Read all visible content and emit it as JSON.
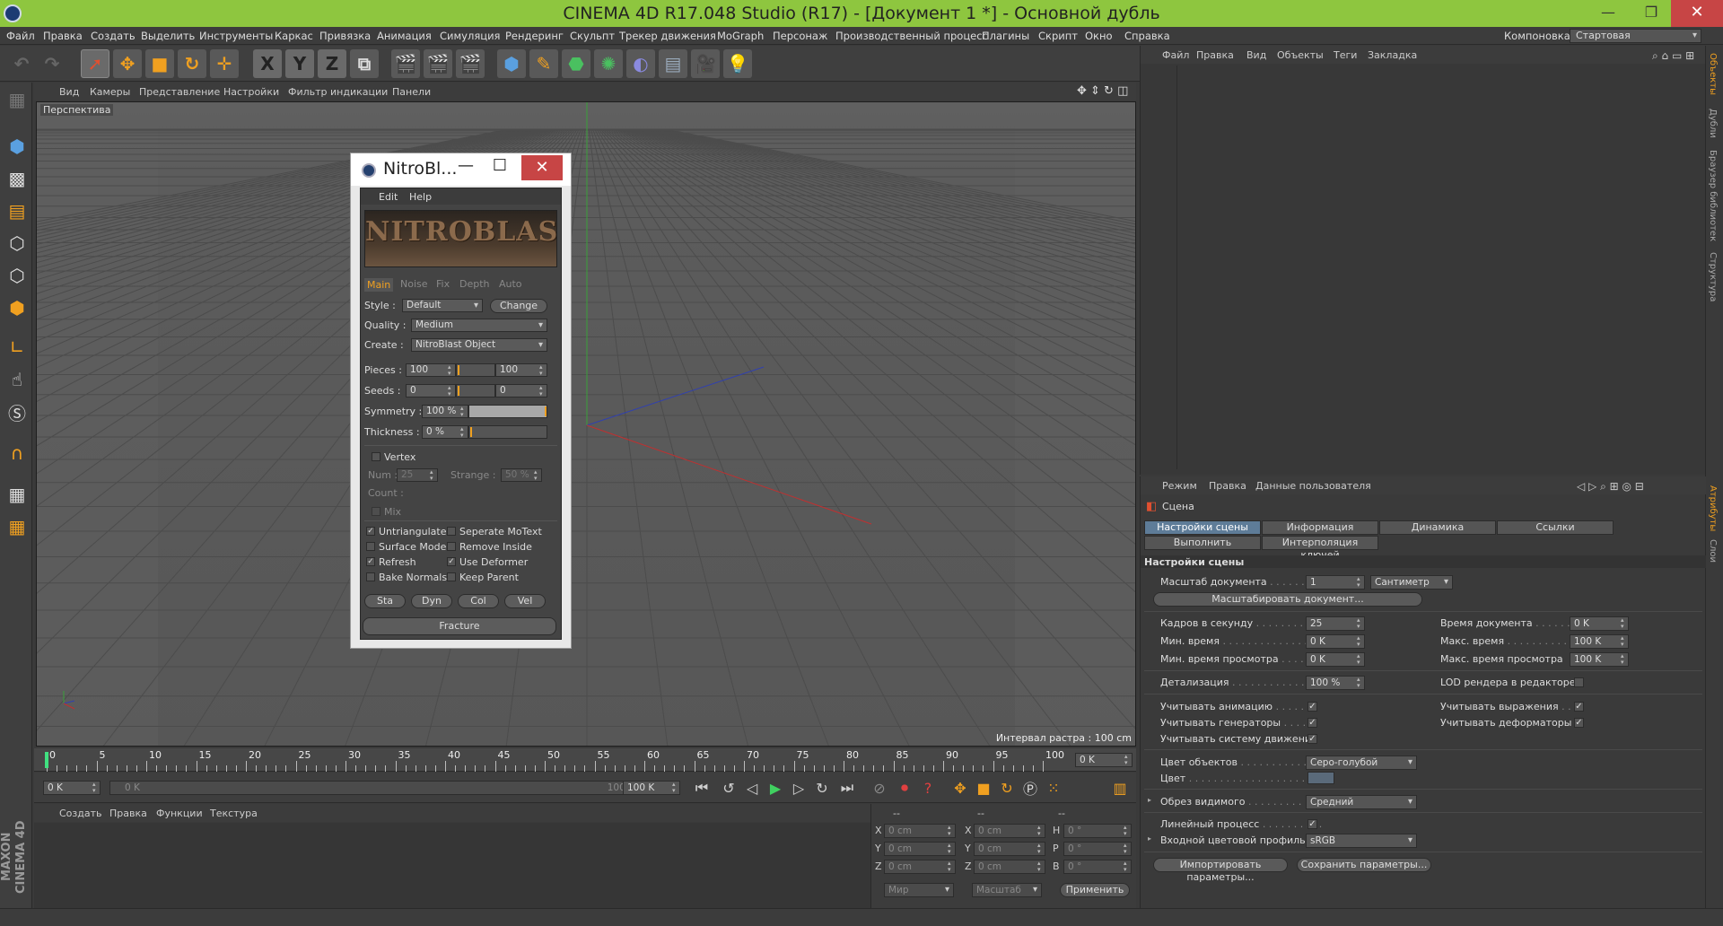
{
  "window": {
    "title": "CINEMA 4D R17.048 Studio (R17) - [Документ 1 *] - Основной дубль",
    "min": "—",
    "max": "❐",
    "close": "✕"
  },
  "menubar": {
    "items": [
      "Файл",
      "Правка",
      "Создать",
      "Выделить",
      "Инструменты",
      "Каркас",
      "Привязка",
      "Анимация",
      "Симуляция",
      "Рендеринг",
      "Скульпт",
      "Трекер движения",
      "MoGraph",
      "Персонаж",
      "Производственный процесс",
      "Плагины",
      "Скрипт",
      "Окно",
      "Справка"
    ],
    "layout_label": "Компоновка",
    "layout_value": "Стартовая"
  },
  "toolbar": {
    "x": "X",
    "y": "Y",
    "z": "Z"
  },
  "viewport": {
    "menu": [
      "Вид",
      "Камеры",
      "Представление",
      "Настройки",
      "Фильтр индикации",
      "Панели"
    ],
    "label": "Перспектива",
    "status": "Интервал растра : 100 cm"
  },
  "timeline": {
    "ticks": [
      "0",
      "5",
      "10",
      "15",
      "20",
      "25",
      "30",
      "35",
      "40",
      "45",
      "50",
      "55",
      "60",
      "65",
      "70",
      "75",
      "80",
      "85",
      "90",
      "95",
      "100"
    ],
    "frame": "0 K"
  },
  "timectrl": {
    "start": "0 K",
    "slider_start": "0 K",
    "slider_end": "100 K",
    "end": "100 K"
  },
  "material": {
    "menu": [
      "Создать",
      "Правка",
      "Функции",
      "Текстура"
    ]
  },
  "coords": {
    "headers": [
      "--",
      "--",
      "--"
    ],
    "rows": [
      {
        "a": "X",
        "v1": "0 cm",
        "b": "X",
        "v2": "0 cm",
        "c": "H",
        "v3": "0 °"
      },
      {
        "a": "Y",
        "v1": "0 cm",
        "b": "Y",
        "v2": "0 cm",
        "c": "P",
        "v3": "0 °"
      },
      {
        "a": "Z",
        "v1": "0 cm",
        "b": "Z",
        "v2": "0 cm",
        "c": "B",
        "v3": "0 °"
      }
    ],
    "world": "Мир",
    "scale": "Масштаб",
    "apply": "Применить"
  },
  "objects": {
    "menu": [
      "Файл",
      "Правка",
      "Вид",
      "Объекты",
      "Теги",
      "Закладка"
    ]
  },
  "right_tabs": [
    "Объекты",
    "Дубли",
    "Браузер библиотек",
    "Структура",
    "Атрибуты",
    "Слои"
  ],
  "attributes": {
    "menu": [
      "Режим",
      "Правка",
      "Данные пользователя"
    ],
    "object": "Сцена",
    "tabs": [
      "Настройки сцены",
      "Информация",
      "Динамика",
      "Ссылки",
      "Выполнить",
      "Интерполяция ключей"
    ],
    "section": "Настройки сцены",
    "doc_scale_label": "Масштаб документа",
    "doc_scale": "1",
    "doc_scale_unit": "Сантиметр",
    "scale_btn": "Масштабировать документ...",
    "fps_label": "Кадров в секунду",
    "fps": "25",
    "doc_time_label": "Время документа",
    "doc_time": "0 K",
    "min_time_label": "Мин. время",
    "min_time": "0 K",
    "max_time_label": "Макс. время",
    "max_time": "100 K",
    "min_prev_label": "Мин. время просмотра",
    "min_prev": "0 K",
    "max_prev_label": "Макс. время просмотра",
    "max_prev": "100 K",
    "lod_label": "Детализация",
    "lod": "100 %",
    "lod_render_label": "LOD рендера в редакторе",
    "use_anim": "Учитывать анимацию",
    "use_expr": "Учитывать выражения",
    "use_gen": "Учитывать генераторы",
    "use_def": "Учитывать деформаторы",
    "use_motion": "Учитывать систему движения",
    "obj_color_label": "Цвет объектов",
    "obj_color": "Серо-голубой",
    "color_label": "Цвет",
    "clip_label": "Обрез видимого",
    "clip": "Средний",
    "linear_label": "Линейный процесс",
    "profile_label": "Входной цветовой профиль",
    "profile": "sRGB",
    "import_btn": "Импортировать параметры...",
    "save_btn": "Сохранить параметры..."
  },
  "nitro": {
    "title": "NitroBl...",
    "menu": [
      "Edit",
      "Help"
    ],
    "logo": "NITROBLAST",
    "tabs": [
      "Main",
      "Noise",
      "Fix",
      "Depth",
      "Auto"
    ],
    "style_label": "Style :",
    "style": "Default",
    "change": "Change",
    "quality_label": "Quality :",
    "quality": "Medium",
    "create_label": "Create :",
    "create": "NitroBlast Object",
    "pieces_label": "Pieces :",
    "pieces": "100",
    "pieces2": "100",
    "seeds_label": "Seeds :",
    "seeds": "0",
    "seeds2": "0",
    "symmetry_label": "Symmetry :",
    "symmetry": "100 %",
    "thickness_label": "Thickness :",
    "thickness": "0 %",
    "vertex": "Vertex",
    "num_label": "Num :",
    "num": "25",
    "strange_label": "Strange :",
    "strange": "50 %",
    "count_label": "Count :",
    "mix": "Mix",
    "checks": [
      "Untriangulate",
      "Seperate MoText",
      "Surface Mode",
      "Remove Inside",
      "Refresh",
      "Use Deformer",
      "Bake Normals",
      "Keep Parent"
    ],
    "buttons": [
      "Sta",
      "Dyn",
      "Col",
      "Vel"
    ],
    "fracture": "Fracture"
  }
}
